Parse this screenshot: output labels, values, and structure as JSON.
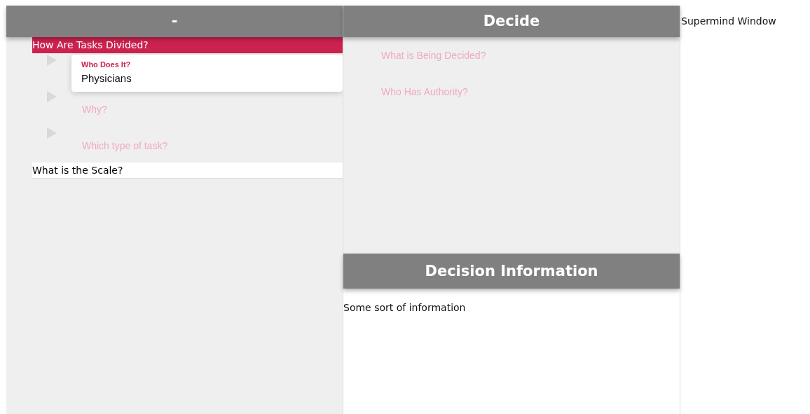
{
  "left_panel": {
    "title": "-",
    "sections": [
      {
        "label": "How Are Tasks Divided?",
        "selected": true,
        "questions": [
          {
            "kind": "answered",
            "label": "Who Does It?",
            "answer": "Physicians"
          },
          {
            "kind": "open",
            "label": "Why?"
          },
          {
            "kind": "open",
            "label": "Which type of task?"
          }
        ]
      },
      {
        "label": "What is the Scale?",
        "selected": false
      }
    ]
  },
  "decide_panel": {
    "title": "Decide",
    "questions": [
      {
        "label": "What is Being Decided?"
      },
      {
        "label": "Who Has Authority?"
      }
    ]
  },
  "info_panel": {
    "title": "Decision Information",
    "text": "Some sort of information"
  },
  "window_label": "Supermind Window"
}
